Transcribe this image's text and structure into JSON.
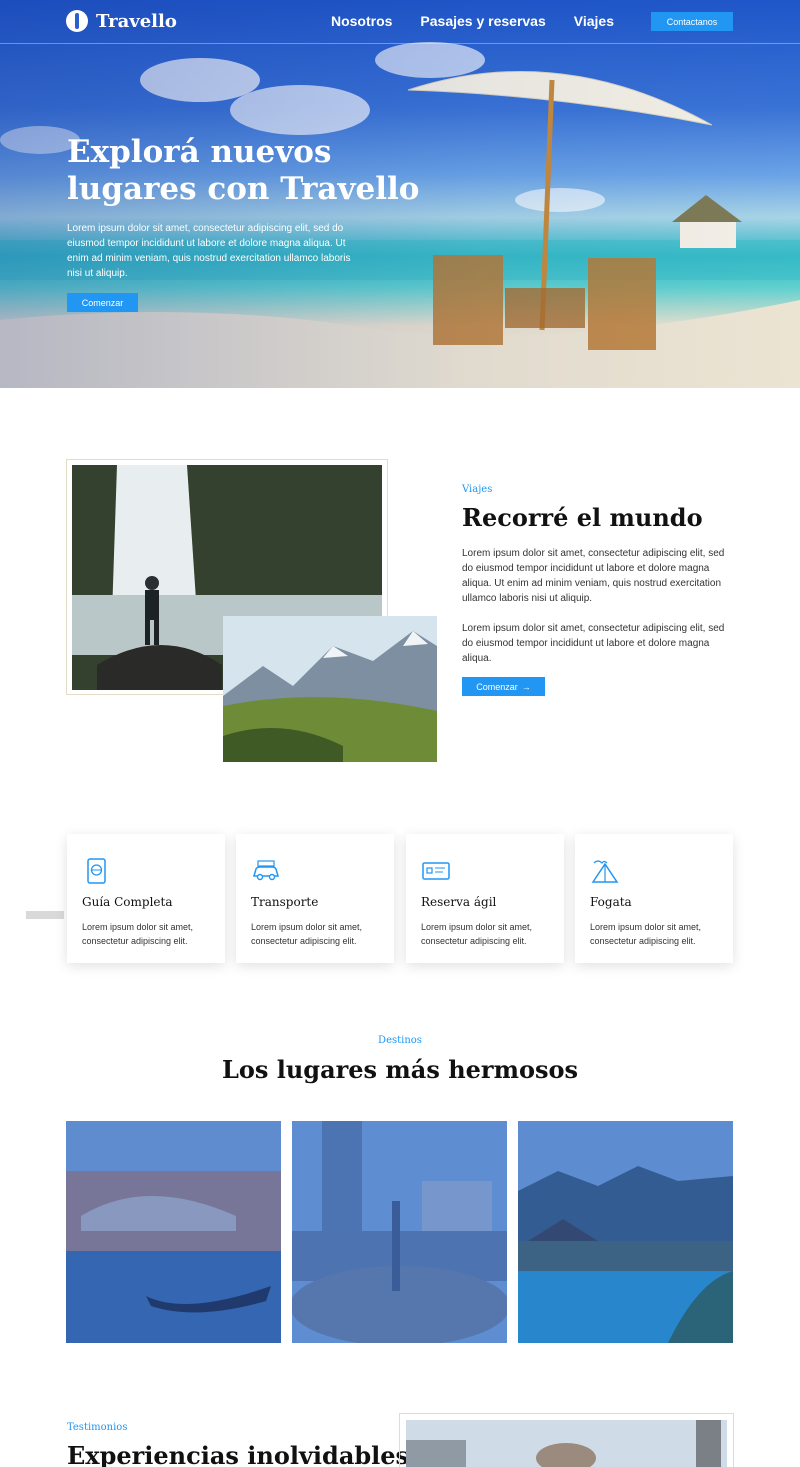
{
  "header": {
    "brand": "Travello",
    "nav": [
      "Nosotros",
      "Pasajes y reservas",
      "Viajes"
    ],
    "contact_label": "Contactanos"
  },
  "hero": {
    "title": "Explorá nuevos lugares con Travello",
    "text": "Lorem ipsum dolor sit amet, consectetur adipiscing elit, sed do eiusmod tempor incididunt ut labore et dolore magna aliqua. Ut enim ad minim veniam, quis nostrud exercitation ullamco laboris nisi ut aliquip.",
    "button": "Comenzar"
  },
  "about": {
    "kicker": "Viajes",
    "title": "Recorré el mundo",
    "p1": "Lorem ipsum dolor sit amet, consectetur adipiscing elit, sed do eiusmod tempor incididunt ut labore et dolore magna aliqua. Ut enim ad minim veniam, quis nostrud exercitation ullamco laboris nisi ut aliquip.",
    "p2": "Lorem ipsum dolor sit amet, consectetur adipiscing elit, sed do eiusmod tempor incididunt ut labore et dolore magna aliqua.",
    "button": "Comenzar",
    "button_icon": "arrow-right-icon"
  },
  "features": [
    {
      "icon": "passport-icon",
      "title": "Guía Completa",
      "text": "Lorem ipsum dolor sit amet, consectetur adipiscing elit."
    },
    {
      "icon": "car-icon",
      "title": "Transporte",
      "text": "Lorem ipsum dolor sit amet, consectetur adipiscing elit."
    },
    {
      "icon": "ticket-card-icon",
      "title": "Reserva ágil",
      "text": "Lorem ipsum dolor sit amet, consectetur adipiscing elit."
    },
    {
      "icon": "tent-icon",
      "title": "Fogata",
      "text": "Lorem ipsum dolor sit amet, consectetur adipiscing elit."
    }
  ],
  "destinations": {
    "kicker": "Destinos",
    "title": "Los lugares más hermosos"
  },
  "testimonials": {
    "kicker": "Testimonios",
    "title": "Experiencias inolvidables"
  },
  "colors": {
    "accent": "#2196f3",
    "hero_blue": "#1f56c9",
    "frame": "#e3dcc6"
  }
}
